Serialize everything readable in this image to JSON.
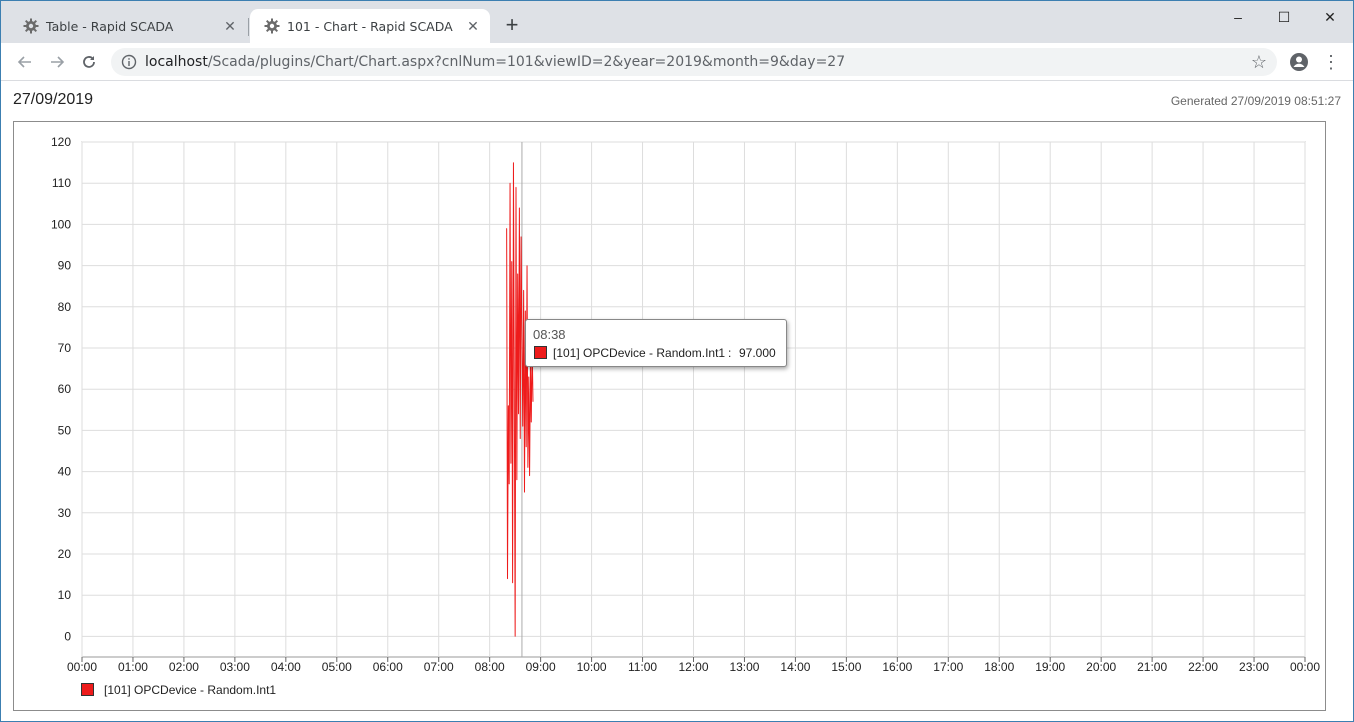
{
  "browser": {
    "tabs": [
      {
        "title": "Table - Rapid SCADA",
        "active": false,
        "icon": "gear-icon"
      },
      {
        "title": "101 - Chart - Rapid SCADA",
        "active": true,
        "icon": "gear-icon"
      }
    ],
    "new_tab_label": "+",
    "url_host": "localhost",
    "url_path": "/Scada/plugins/Chart/Chart.aspx?cnlNum=101&viewID=2&year=2019&month=9&day=27",
    "controls": {
      "minimize": "–",
      "maximize": "☐",
      "close": "✕"
    }
  },
  "page": {
    "date": "27/09/2019",
    "generated": "Generated 27/09/2019 08:51:27"
  },
  "tooltip": {
    "time": "08:38",
    "series": "[101] OPCDevice - Random.Int1",
    "separator": ":",
    "value": "97.000"
  },
  "legend": {
    "label": "[101] OPCDevice - Random.Int1",
    "color": "#ee1b1b"
  },
  "chart_data": {
    "type": "line",
    "title": "",
    "xlabel": "",
    "ylabel": "",
    "ylim": [
      -5,
      120
    ],
    "yticks": [
      0,
      10,
      20,
      30,
      40,
      50,
      60,
      70,
      80,
      90,
      100,
      110,
      120
    ],
    "xticks": [
      "00:00",
      "01:00",
      "02:00",
      "03:00",
      "04:00",
      "05:00",
      "06:00",
      "07:00",
      "08:00",
      "09:00",
      "10:00",
      "11:00",
      "12:00",
      "13:00",
      "14:00",
      "15:00",
      "16:00",
      "17:00",
      "18:00",
      "19:00",
      "20:00",
      "21:00",
      "22:00",
      "23:00",
      "00:00"
    ],
    "grid": true,
    "legend_position": "bottom-left",
    "series": [
      {
        "name": "[101] OPCDevice - Random.Int1",
        "color": "#ee1b1b",
        "x": [
          "08:20",
          "08:21",
          "08:22",
          "08:23",
          "08:24",
          "08:25",
          "08:26",
          "08:27",
          "08:28",
          "08:29",
          "08:30",
          "08:31",
          "08:32",
          "08:33",
          "08:34",
          "08:35",
          "08:36",
          "08:37",
          "08:38",
          "08:39",
          "08:40",
          "08:41",
          "08:42",
          "08:43",
          "08:44",
          "08:45",
          "08:46",
          "08:47",
          "08:48",
          "08:49",
          "08:50",
          "08:51"
        ],
        "y": [
          99,
          14,
          56,
          37,
          110,
          42,
          91,
          13,
          115,
          60,
          0,
          109,
          38,
          88,
          54,
          104,
          48,
          97,
          72,
          51,
          84,
          35,
          79,
          46,
          90,
          41,
          63,
          39,
          66,
          52,
          71,
          57
        ]
      }
    ],
    "crosshair_x": "08:38"
  }
}
